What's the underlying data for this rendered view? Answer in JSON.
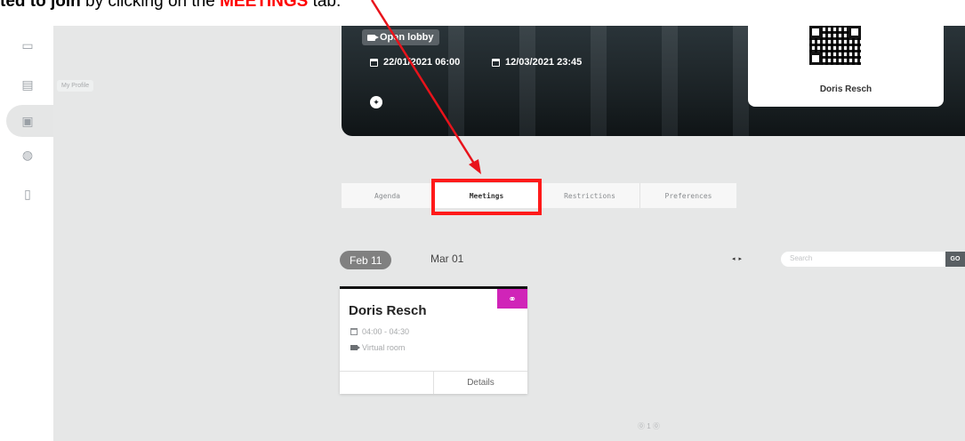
{
  "caption": {
    "part1": "ted to join",
    "part2": " by clicking on the ",
    "part3": "MEETINGS",
    "part4": " tab."
  },
  "sidebar": {
    "items": [
      {
        "name": "monitor-icon",
        "glyph": "▭"
      },
      {
        "name": "profile-card-icon",
        "glyph": "▤"
      },
      {
        "name": "calendar-icon",
        "glyph": "▣"
      },
      {
        "name": "globe-icon",
        "glyph": "◍"
      },
      {
        "name": "document-icon",
        "glyph": "▯"
      }
    ],
    "tooltip": "My Profile"
  },
  "banner": {
    "open_lobby": "Open lobby",
    "start": "22/01/2021 06:00",
    "end": "12/03/2021 23:45",
    "twitter_glyph": "✦"
  },
  "card": {
    "name": "Doris Resch"
  },
  "tabs": [
    {
      "label": "Agenda",
      "active": false
    },
    {
      "label": "Meetings",
      "active": true
    },
    {
      "label": "Restrictions",
      "active": false
    },
    {
      "label": "Preferences",
      "active": false
    }
  ],
  "dates": {
    "selected": "Feb 11",
    "other": "Mar 01"
  },
  "search": {
    "placeholder": "Search",
    "go": "GO",
    "arrows": "◂▸"
  },
  "meeting": {
    "title": "Doris Resch",
    "time": "04:00 - 04:30",
    "room": "Virtual room",
    "details": "Details",
    "badge_glyph": "⚭"
  },
  "pagination": "⓪ 1 ⓪",
  "colors": {
    "highlight": "#ff1a1a",
    "badge": "#d024b8",
    "arrow": "#e8131b"
  }
}
